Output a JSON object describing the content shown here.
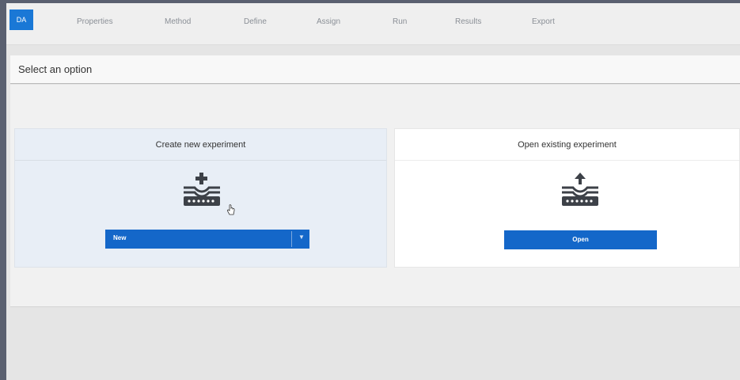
{
  "app": {
    "logo_text": "DA"
  },
  "nav": {
    "tabs": [
      "Properties",
      "Method",
      "Define",
      "Assign",
      "Run",
      "Results",
      "Export"
    ]
  },
  "header": {
    "title": "Select an option"
  },
  "panels": {
    "create": {
      "title": "Create new experiment",
      "icon": "plate-add-icon",
      "button_label": "New",
      "dropdown_icon": "chevron-down-icon"
    },
    "open": {
      "title": "Open existing experiment",
      "icon": "plate-upload-icon",
      "button_label": "Open"
    }
  },
  "colors": {
    "accent": "#1467c9",
    "logo_bg": "#1a78d6",
    "create_panel_bg": "#e8eef6",
    "open_panel_bg": "#ffffff"
  }
}
